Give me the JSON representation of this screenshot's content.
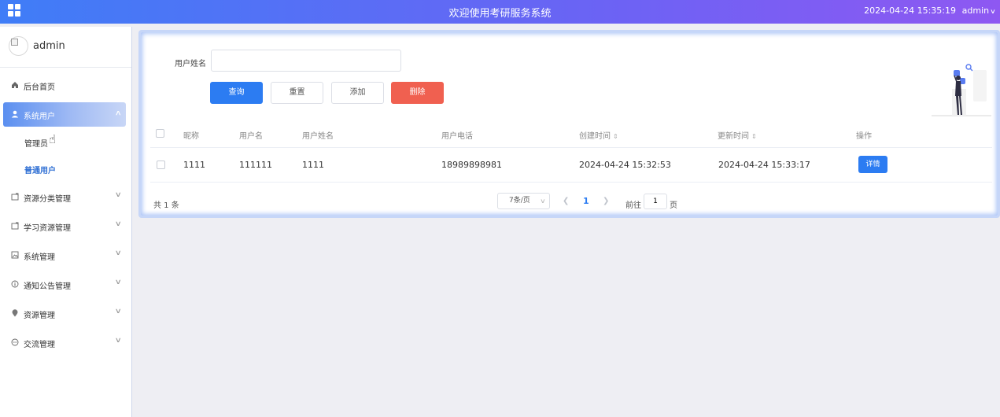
{
  "header": {
    "title": "欢迎使用考研服务系统",
    "datetime": "2024-04-24 15:35:19",
    "user": "admin",
    "menu_icon": "grid-icon"
  },
  "sidebar": {
    "username": "admin",
    "items": [
      {
        "label": "后台首页",
        "icon": "home-icon"
      },
      {
        "label": "系统用户",
        "icon": "user-icon",
        "expanded": true,
        "children": [
          {
            "label": "管理员"
          },
          {
            "label": "普通用户",
            "current": true
          }
        ]
      },
      {
        "label": "资源分类管理",
        "icon": "folder-icon"
      },
      {
        "label": "学习资源管理",
        "icon": "folder-icon"
      },
      {
        "label": "系统管理",
        "icon": "picture-icon"
      },
      {
        "label": "通知公告管理",
        "icon": "info-icon"
      },
      {
        "label": "资源管理",
        "icon": "location-icon"
      },
      {
        "label": "交流管理",
        "icon": "chat-icon"
      }
    ]
  },
  "search": {
    "label": "用户姓名",
    "value": "",
    "placeholder": ""
  },
  "buttons": {
    "query": "查询",
    "reset": "重置",
    "add": "添加",
    "delete": "删除"
  },
  "table": {
    "columns": [
      "昵称",
      "用户名",
      "用户姓名",
      "用户电话",
      "创建时间",
      "更新时间",
      "操作"
    ],
    "rows": [
      {
        "nickname": "1111",
        "username": "111111",
        "realname": "1111",
        "phone": "18989898981",
        "created": "2024-04-24 15:32:53",
        "updated": "2024-04-24 15:33:17",
        "action": "详情"
      }
    ]
  },
  "pagination": {
    "total": "共 1 条",
    "page_size": "7条/页",
    "current_page": "1",
    "goto_label": "前往",
    "goto_value": "1",
    "page_suffix": "页"
  },
  "colors": {
    "primary": "#2c7cf2",
    "danger": "#f06050",
    "header_start": "#3f7df7",
    "header_end": "#8e58f2"
  }
}
